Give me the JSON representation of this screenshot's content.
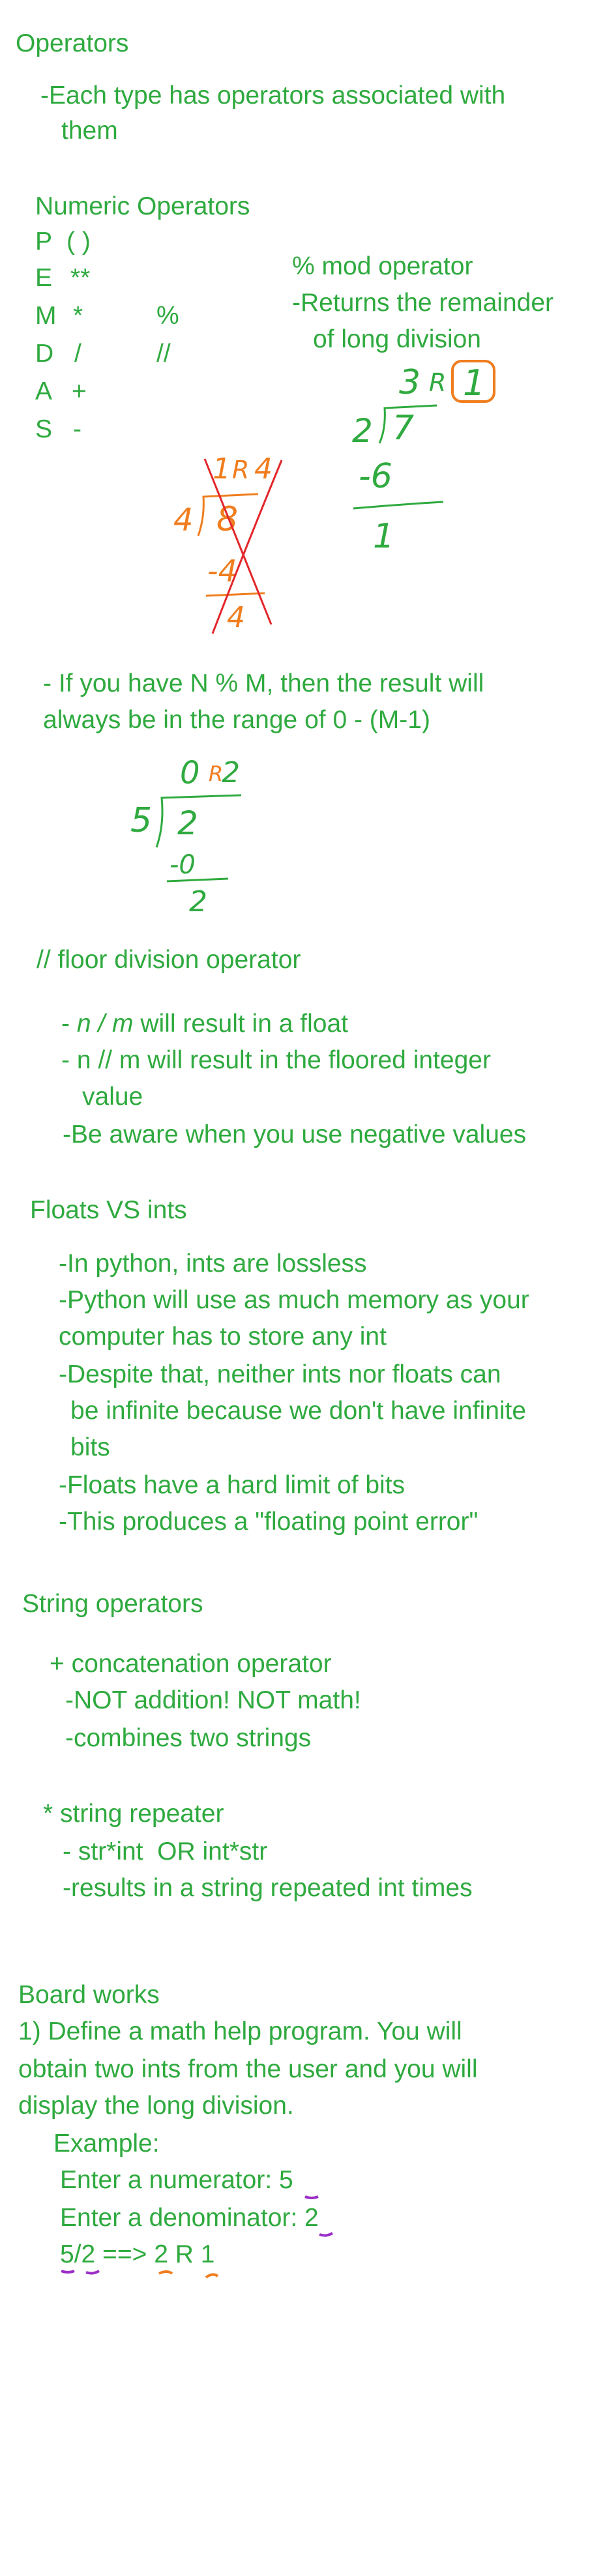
{
  "page": {
    "title": "Operators"
  },
  "section_operators": {
    "intro_line1": "-Each type has operators associated with",
    "intro_line2": "them",
    "numeric_heading": "Numeric Operators",
    "pemdas": [
      {
        "letter": "P",
        "symbol": "( )"
      },
      {
        "letter": "E",
        "symbol": "**"
      },
      {
        "letter": "M",
        "symbol": "*"
      },
      {
        "letter": "D",
        "symbol": "/"
      },
      {
        "letter": "A",
        "symbol": "+"
      },
      {
        "letter": "S",
        "symbol": "-"
      }
    ],
    "extra_symbols": [
      "%",
      "//"
    ],
    "mod_heading": "% mod operator",
    "mod_desc_line1": "-Returns the remainder",
    "mod_desc_line2": "of long division",
    "range_line1": "- If you have N % M, then the result will",
    "range_line2": "always be in the range of 0 - (M-1)"
  },
  "handwriting": {
    "colors": {
      "green": "#2faa3f",
      "orange": "#f07d1e",
      "red": "#e3262a",
      "purple": "#9b2fc8"
    },
    "example_7_mod_2": {
      "quotient": "3",
      "remainder_label": "R",
      "remainder": "1",
      "divisor": "2",
      "dividend": "7",
      "subtract": "-6",
      "result": "1"
    },
    "crossed_example": {
      "quotient": "1",
      "remainder_label": "R",
      "remainder": "4",
      "divisor": "4",
      "dividend": "8",
      "subtract": "-4",
      "result": "4"
    },
    "example_2_mod_5": {
      "quotient": "0",
      "remainder_label": "R",
      "remainder": "2",
      "divisor": "5",
      "dividend": "2",
      "subtract": "-0",
      "result": "2"
    }
  },
  "section_floor": {
    "heading": "// floor division operator",
    "line1_code": "n / m",
    "line1_rest": " will result in a float",
    "line2": "- n // m will result in the floored integer",
    "line2_cont": "value",
    "line3": "-Be aware when you use negative values"
  },
  "section_floats": {
    "heading": "Floats VS ints",
    "lines": [
      "-In python, ints are lossless",
      "-Python will use as much memory as your",
      "computer has to store any int",
      "-Despite that, neither ints nor floats can",
      "be infinite because we don't have infinite",
      "bits",
      "-Floats have a hard limit of bits",
      "-This produces a \"floating point error\""
    ]
  },
  "section_strings": {
    "heading": "String operators",
    "concat_heading": "+ concatenation operator",
    "concat_line1": "-NOT addition! NOT math!",
    "concat_line2": "-combines two strings",
    "repeat_heading": "* string repeater",
    "repeat_line1": "- str*int  OR int*str",
    "repeat_line2": "-results in a string repeated int times"
  },
  "section_board": {
    "heading": "Board works",
    "task_line1": "1) Define a math help program. You will",
    "task_line2": "obtain two ints from the user and you will",
    "task_line3": "display the long division.",
    "example_label": "Example:",
    "numerator_prompt": "Enter a numerator: 5",
    "denominator_prompt": "Enter a denominator: 2",
    "output": "5/2 ==> 2 R 1"
  }
}
